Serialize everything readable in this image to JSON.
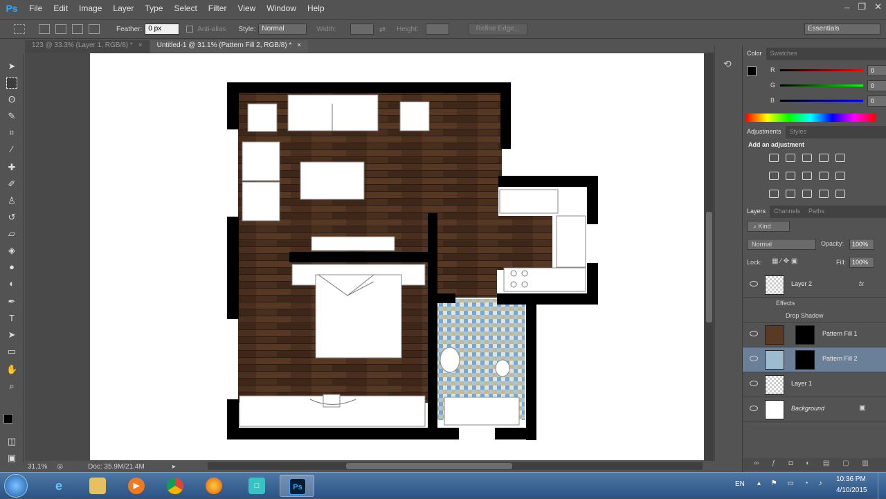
{
  "app": {
    "logo": "Ps"
  },
  "menu": [
    "File",
    "Edit",
    "Image",
    "Layer",
    "Type",
    "Select",
    "Filter",
    "View",
    "Window",
    "Help"
  ],
  "options": {
    "feather_label": "Feather:",
    "feather_value": "0 px",
    "antialias_label": "Anti-alias",
    "style_label": "Style:",
    "style_value": "Normal",
    "width_label": "Width:",
    "height_label": "Height:",
    "refine_edge": "Refine Edge...",
    "workspace": "Essentials"
  },
  "tabs": [
    {
      "label": "123 @ 33.3% (Layer 1, RGB/8) *",
      "close": "×"
    },
    {
      "label": "Untitled-1 @ 31.1% (Pattern Fill 2, RGB/8) *",
      "close": "×"
    }
  ],
  "status": {
    "zoom": "31.1%",
    "doc": "Doc: 35.9M/21.4M"
  },
  "color_panel": {
    "tabs": [
      "Color",
      "Swatches"
    ],
    "channels": [
      {
        "label": "R",
        "value": "0"
      },
      {
        "label": "G",
        "value": "0"
      },
      {
        "label": "B",
        "value": "0"
      }
    ]
  },
  "adjustments_panel": {
    "tabs": [
      "Adjustments",
      "Styles"
    ],
    "heading": "Add an adjustment"
  },
  "layers_panel": {
    "tabs": [
      "Layers",
      "Channels",
      "Paths"
    ],
    "filter_kind": "Kind",
    "blend_mode": "Normal",
    "opacity_label": "Opacity:",
    "opacity_value": "100%",
    "lock_label": "Lock:",
    "fill_label": "Fill:",
    "fill_value": "100%",
    "effects_label": "Effects",
    "drop_shadow_label": "Drop Shadow",
    "fx": "fx",
    "layers": [
      {
        "name": "Layer 2"
      },
      {
        "name": "Pattern Fill 1"
      },
      {
        "name": "Pattern Fill 2"
      },
      {
        "name": "Layer 1"
      },
      {
        "name": "Background"
      }
    ]
  },
  "taskbar": {
    "lang": "EN",
    "time": "10:36 PM",
    "date": "4/10/2015",
    "ps_label": "Ps"
  }
}
